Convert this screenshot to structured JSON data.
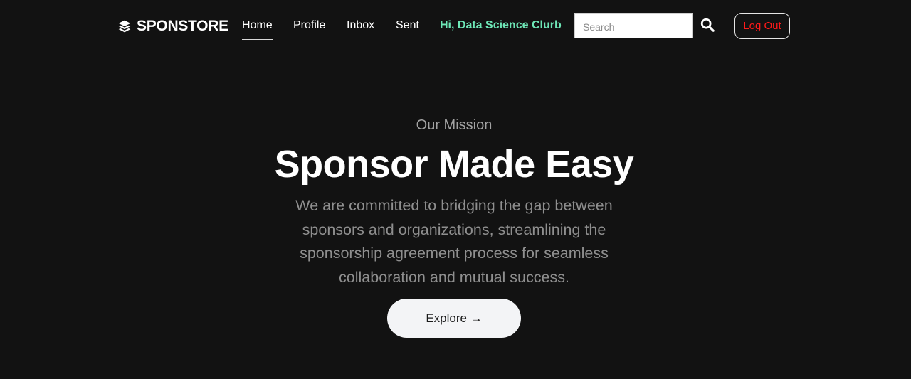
{
  "navbar": {
    "brand": {
      "name": "SPONSTORE",
      "icon": "layers-icon"
    },
    "links": [
      {
        "label": "Home",
        "active": true
      },
      {
        "label": "Profile",
        "active": false
      },
      {
        "label": "Inbox",
        "active": false
      },
      {
        "label": "Sent",
        "active": false
      }
    ],
    "greeting": "Hi, Data Science Clurb",
    "search": {
      "placeholder": "Search",
      "value": "",
      "icon": "search-icon"
    },
    "logout_label": "Log Out"
  },
  "hero": {
    "eyebrow": "Our Mission",
    "title": "Sponsor Made Easy",
    "description": "We are committed to bridging the gap between sponsors and organizations, streamlining the sponsorship agreement process for seamless collaboration and mutual success.",
    "cta_label": "Explore →"
  },
  "colors": {
    "background": "#121212",
    "greeting": "#6ee7b7",
    "logout": "#ff1a1a",
    "cta_background": "#f3f4f6"
  }
}
